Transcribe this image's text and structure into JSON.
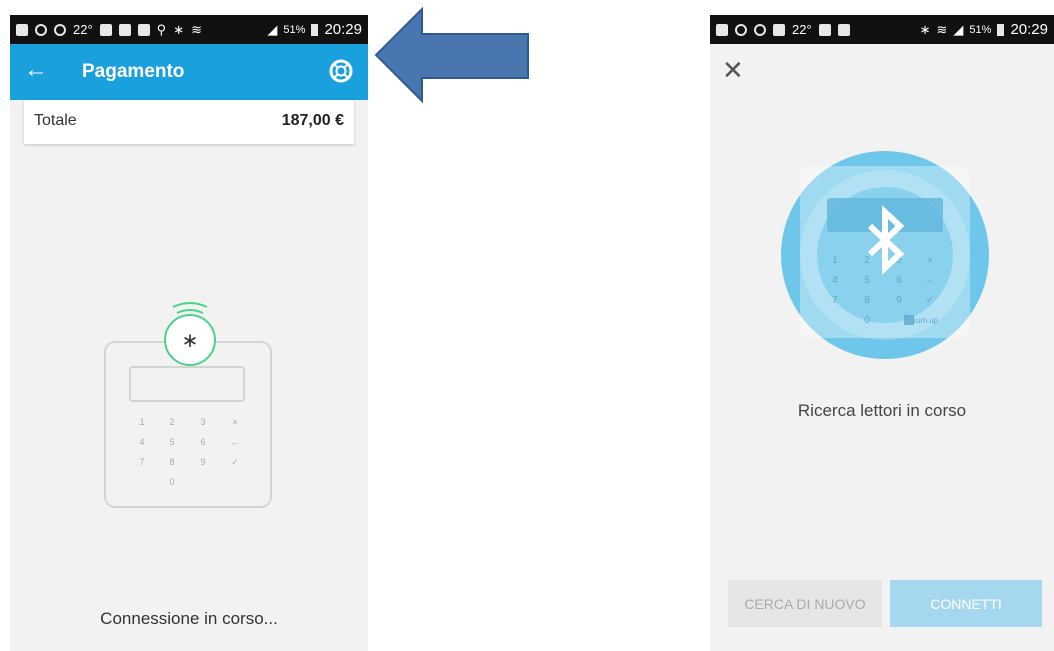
{
  "left_screen": {
    "status": {
      "temperature": "22°",
      "battery": "51%",
      "time": "20:29"
    },
    "appbar": {
      "title": "Pagamento"
    },
    "total": {
      "label": "Totale",
      "value": "187,00 €"
    },
    "keypad": [
      "1",
      "2",
      "3",
      "×",
      "4",
      "5",
      "6",
      "←",
      "7",
      "8",
      "9",
      "✓",
      "0"
    ],
    "message": "Connessione in corso..."
  },
  "right_screen": {
    "status": {
      "temperature": "22°",
      "battery": "51%",
      "time": "20:29"
    },
    "keypad": [
      "1",
      "2",
      "3",
      "×",
      "4",
      "5",
      "6",
      "←",
      "7",
      "8",
      "9",
      "✓",
      "0"
    ],
    "brand": "sum up",
    "message": "Ricerca lettori in corso",
    "buttons": {
      "search_again": "CERCA DI NUOVO",
      "connect": "CONNETTI"
    }
  },
  "colors": {
    "appbar": "#1aa0dc",
    "accent_green": "#4cd38a",
    "circle_blue": "#6ec6ea",
    "arrow": "#4a76b0"
  }
}
